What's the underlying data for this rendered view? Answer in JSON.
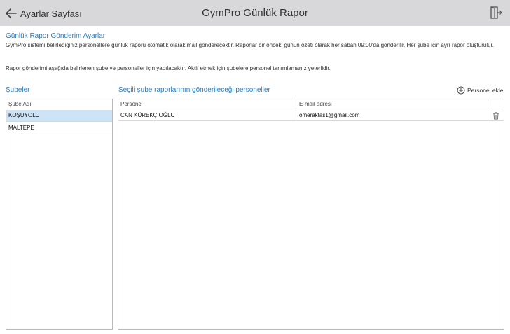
{
  "header": {
    "back_label": "Ayarlar Sayfası",
    "title": "GymPro Günlük Rapor"
  },
  "settings": {
    "section_title": "Günlük Rapor Gönderim Ayarları",
    "description1": "GymPro sistemi belirlediğiniz personellere günlük raporu otomatik olarak mail gönderecektir. Raporlar bir önceki günün özeti olarak her sabah 09:00'da gönderilir. Her şube için ayrı rapor oluşturulur.",
    "description2": "Rapor gönderimi aşağıda belirlenen şube ve personeller için yapılacaktır. Aktif etmek için şubelere personel tanımlamanız yeterlidir."
  },
  "branches": {
    "label": "Şubeler",
    "column": "Şube Adı",
    "items": [
      {
        "name": "KOŞUYOLU",
        "selected": true
      },
      {
        "name": "MALTEPE",
        "selected": false
      }
    ]
  },
  "staff": {
    "label": "Seçili şube raporlarının gönderileceği personeller",
    "add_label": "Personel ekle",
    "columns": [
      "Personel",
      "E-mail adresi"
    ],
    "rows": [
      {
        "name": "CAN KÜREKÇİOĞLU",
        "email": "omeraktas1@gmail.com"
      }
    ]
  },
  "colors": {
    "accent": "#2a7fc1",
    "selected_row": "#cde4f7",
    "topbar": "#d8d8da"
  }
}
